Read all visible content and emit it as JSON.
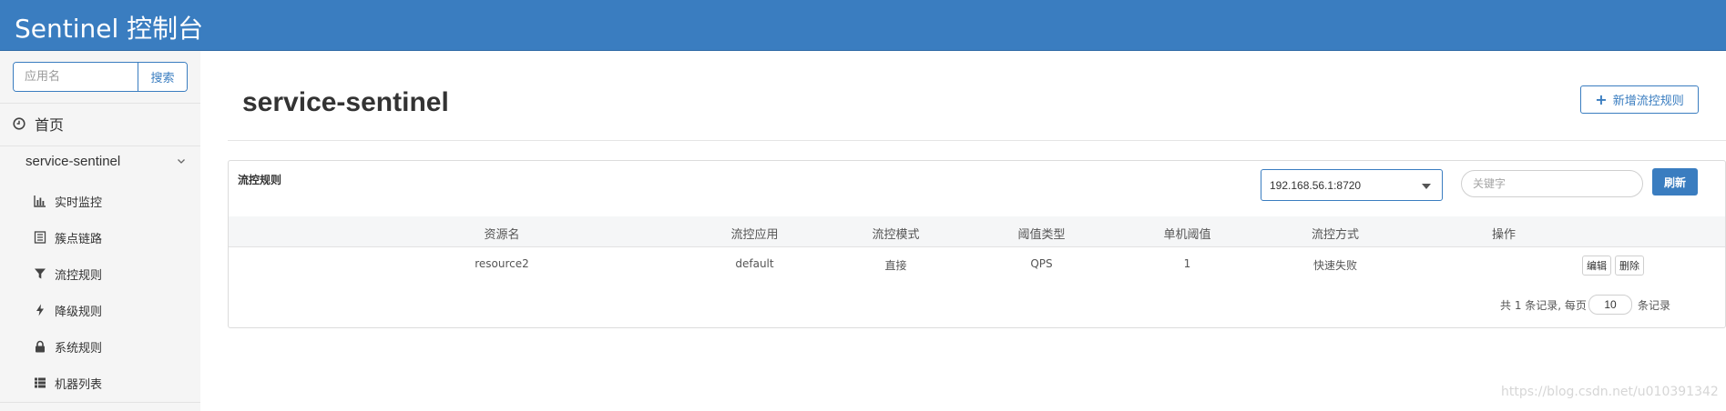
{
  "app": {
    "title": "Sentinel 控制台"
  },
  "sidebar": {
    "search": {
      "placeholder": "应用名",
      "button_label": "搜索"
    },
    "home": {
      "label": "首页",
      "icon": "dashboard-icon"
    },
    "app_name": "service-sentinel",
    "items": [
      {
        "label": "实时监控",
        "icon": "bar-chart-icon"
      },
      {
        "label": "簇点链路",
        "icon": "list-alt-icon"
      },
      {
        "label": "流控规则",
        "icon": "filter-icon"
      },
      {
        "label": "降级规则",
        "icon": "flash-icon"
      },
      {
        "label": "系统规则",
        "icon": "lock-icon"
      },
      {
        "label": "机器列表",
        "icon": "th-list-icon"
      }
    ]
  },
  "main": {
    "page_title": "service-sentinel",
    "add_button_label": "新增流控规则",
    "panel_title": "流控规则",
    "machine_select": {
      "value": "192.168.56.1:8720"
    },
    "keyword": {
      "placeholder": "关键字",
      "value": ""
    },
    "refresh_label": "刷新",
    "table": {
      "columns": [
        "资源名",
        "流控应用",
        "流控模式",
        "阈值类型",
        "单机阈值",
        "流控方式",
        "操作"
      ],
      "rows": [
        {
          "resource": "resource2",
          "limit_app": "default",
          "mode": "直接",
          "grade": "QPS",
          "count": "1",
          "behavior": "快速失败",
          "edit_label": "编辑",
          "delete_label": "删除"
        }
      ]
    },
    "pager": {
      "prefix": "共 1 条记录, 每页",
      "page_size": "10",
      "suffix": "条记录"
    }
  },
  "watermark": "https://blog.csdn.net/u010391342",
  "colors": {
    "primary": "#3a7dc0",
    "sidebar_bg": "#f5f5f5",
    "table_header_bg": "#f5f6f7"
  }
}
